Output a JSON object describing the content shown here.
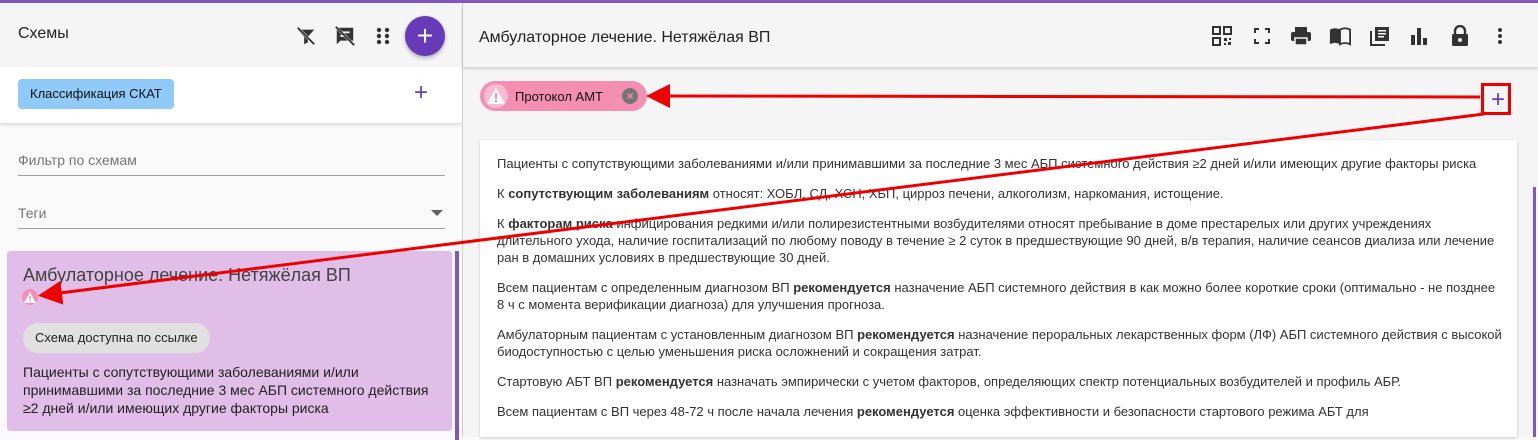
{
  "left": {
    "title": "Схемы",
    "add_button": "+",
    "classification_chip": "Классификация СКАТ",
    "add_class_label": "+",
    "filter": {
      "placeholder": "Фильтр по схемам",
      "value": ""
    },
    "tags": {
      "placeholder": "Теги",
      "value": ""
    },
    "card": {
      "title": "Амбулаторное лечение. Нетяжёлая ВП",
      "link_chip": "Схема доступна по ссылке",
      "description": "Пациенты с сопутствующими заболеваниями и/или принимавшими за последние 3 мес АБП системного действия ≥2 дней и/или имеющих другие факторы риска"
    },
    "icons": [
      "filter-off-icon",
      "comment-off-icon",
      "drag-dots-icon",
      "add-icon"
    ]
  },
  "right": {
    "title": "Амбулаторное лечение. Нетяжёлая ВП",
    "toolbar_icons": [
      "qr-code-icon",
      "fullscreen-icon",
      "print-icon",
      "book-icon",
      "library-icon",
      "bar-chart-icon",
      "lock-icon",
      "more-vert-icon"
    ],
    "protocol_chip": "Протокол АМТ",
    "add_label": "+",
    "paragraphs": [
      [
        "Пациенты с сопутствующими заболеваниями и/или принимавшими за последние 3 мес АБП системного действия ≥2 дней и/или имеющих другие факторы риска"
      ],
      [
        "К ",
        "сопутствующим заболеваниям",
        " относят: ХОБЛ, СД, ХСН, ХБП, цирроз печени, алкоголизм, наркомания, истощение."
      ],
      [
        "К ",
        "факторам риска",
        " инфицирования редкими и/или полирезистентными возбудителями относят пребывание в доме престарелых или других учреждениях длительного ухода, наличие госпитализаций по любому поводу в течение ≥ 2 суток в предшествующие 90 дней, в/в терапия, наличие сеансов диализа или лечение ран в домашних условиях в предшествующие 30 дней."
      ],
      [
        "Всем пациентам с определенным диагнозом ВП ",
        "рекомендуется",
        " назначение АБП системного действия в как можно более короткие сроки (оптимально - не позднее 8 ч с момента верификации диагноза) для улучшения прогноза."
      ],
      [
        "Амбулаторным пациентам с установленным диагнозом ВП ",
        "рекомендуется",
        " назначение пероральных лекарственных форм (ЛФ) АБП системного действия с высокой биодоступностью с целью уменьшения риска осложнений и сокращения затрат."
      ],
      [
        "Стартовую АБТ ВП ",
        "рекомендуется",
        " назначать эмпирически с учетом факторов, определяющих спектр потенциальных возбудителей и профиль АБР."
      ],
      [
        "Всем пациентам с ВП через 48-72 ч после начала лечения ",
        "рекомендуется",
        " оценка эффективности и безопасности стартового режима АБТ для"
      ]
    ]
  },
  "colors": {
    "accent": "#673ab7",
    "card_bg": "#e1bee7",
    "chip_blue": "#90caf9",
    "chip_pink": "#f48fb1",
    "annotation": "#e00000"
  }
}
